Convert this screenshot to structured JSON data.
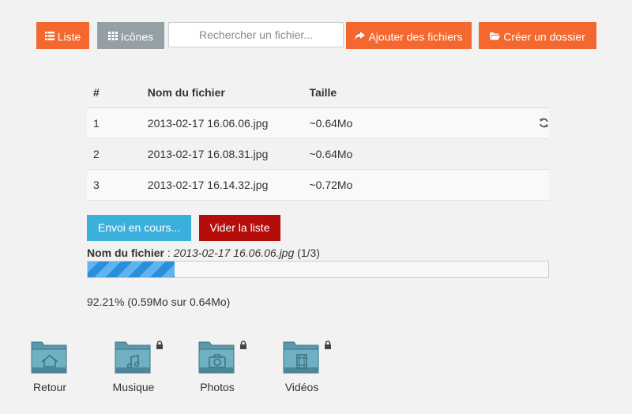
{
  "toolbar": {
    "list_label": "Liste",
    "icons_label": "Icônes",
    "search_placeholder": "Rechercher un fichier...",
    "add_files_label": "Ajouter des fichiers",
    "create_folder_label": "Créer un dossier"
  },
  "table": {
    "headers": [
      "#",
      "Nom du fichier",
      "Taille"
    ],
    "rows": [
      {
        "num": "1",
        "name": "2013-02-17 16.06.06.jpg",
        "size": "~0.64Mo",
        "icon": "refresh-icon"
      },
      {
        "num": "2",
        "name": "2013-02-17 16.08.31.jpg",
        "size": "~0.64Mo"
      },
      {
        "num": "3",
        "name": "2013-02-17 16.14.32.jpg",
        "size": "~0.72Mo"
      }
    ]
  },
  "upload": {
    "sending_label": "Envoi en cours...",
    "clear_label": "Vider la liste",
    "file_label": "Nom du fichier",
    "current_file": "2013-02-17 16.06.06.jpg",
    "counter": "(1/3)",
    "progress_fraction": 0.1883,
    "percent_text": "92.21% (0.59Mo sur 0.64Mo)"
  },
  "folders": [
    {
      "label": "Retour",
      "icon": "home-icon",
      "locked": false
    },
    {
      "label": "Musique",
      "icon": "music-icon",
      "locked": true
    },
    {
      "label": "Photos",
      "icon": "camera-icon",
      "locked": true
    },
    {
      "label": "Vidéos",
      "icon": "film-icon",
      "locked": true
    }
  ],
  "colors": {
    "orange": "#f2682f",
    "grey": "#95a0a6",
    "blue": "#3bb0dd",
    "red": "#b50c0c",
    "folder": "#5a98ab"
  }
}
